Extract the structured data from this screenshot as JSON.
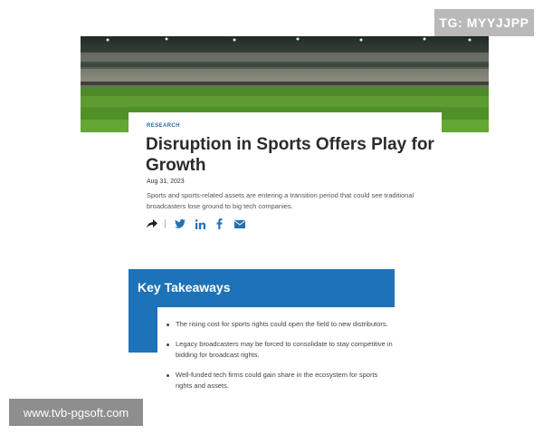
{
  "watermarks": {
    "top": "TG: MYYJJPP",
    "bottom": "www.tvb-pgsoft.com"
  },
  "hero": {
    "icon": "stadium-image",
    "colors": {
      "sky": "#1f2a22",
      "stands": "#7a7c73",
      "grass": "#55922c"
    }
  },
  "article": {
    "category": "RESEARCH",
    "title": "Disruption in Sports Offers Play for Growth",
    "date": "Aug 31, 2023",
    "summary": "Sports and sports-related assets are entering a transition period that could see traditional broadcasters lose ground to big tech companies.",
    "share": [
      {
        "name": "share-icon",
        "color": "#222222"
      },
      {
        "name": "twitter-icon",
        "color": "#1e72b7"
      },
      {
        "name": "linkedin-icon",
        "color": "#1e72b7"
      },
      {
        "name": "facebook-icon",
        "color": "#1e72b7"
      },
      {
        "name": "email-icon",
        "color": "#1e72b7"
      }
    ]
  },
  "key_takeaways": {
    "title": "Key Takeaways",
    "accent_color": "#1e72b7",
    "items": [
      "The rising cost for sports rights could open the field to new distributors.",
      "Legacy broadcasters may be forced to consolidate to stay competitive in bidding for broadcast rights.",
      "Well-funded tech firms could gain share in the ecosystem for sports rights and assets."
    ]
  }
}
